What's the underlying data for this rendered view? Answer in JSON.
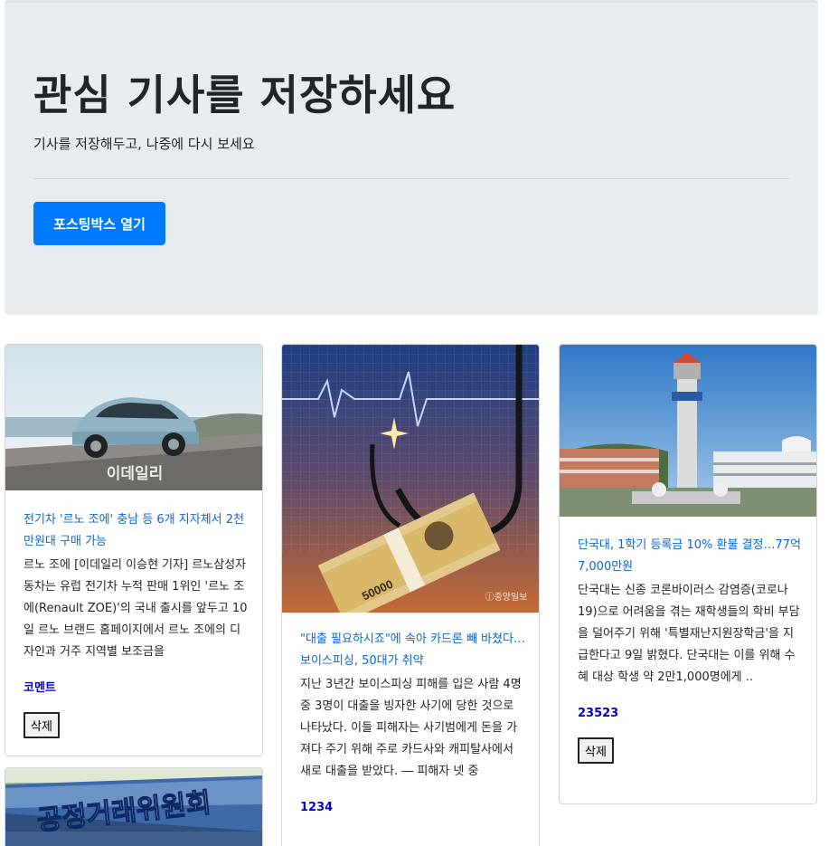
{
  "hero": {
    "title": "관심 기사를 저장하세요",
    "subtitle": "기사를 저장해두고, 나중에 다시 보세요",
    "button_label": "포스팅박스 열기",
    "button_color": "#007bff",
    "background": "#e9ecef"
  },
  "cards": [
    {
      "title": "전기차 '르노 조에' 충남 등 6개 지자체서 2천만원대 구매 가능",
      "description": "르노 조에 [이데일리 이승현 기자] 르노삼성자동차는 유럽 전기차 누적 판매 1위인 '르노 조에(Renault ZOE)'의 국내 출시를 앞두고 10일 르노 브랜드 홈페이지에서 르노 조에의 디자인과 거주 지역별 보조금을",
      "comment": "코멘트",
      "delete_label": "삭제",
      "image_watermark": "이데일리"
    },
    {
      "title": "\"대출 필요하시죠\"에 속아 카드론 빼 바쳤다…보이스피싱, 50대가 취약",
      "description": "지난 3년간 보이스피싱 피해를 입은 사람 4명 중 3명이 대출을 빙자한 사기에 당한 것으로 나타났다. 이들 피해자는 사기범에게 돈을 가져다 주기 위해 주로 카드사와 캐피탈사에서 새로 대출을 받았다. ― 피해자 넷 중",
      "comment": "1234",
      "image_watermark": "ⓙ중앙일보",
      "image_banknote": "50000"
    },
    {
      "title": "단국대, 1학기 등록금 10% 환불 결정…77억7,000만원",
      "description": "단국대는 신종 코론바이러스 감염증(코로나19)으로 어려움을 겪는 재학생들의 학비 부담을 덜어주기 위해 '특별재난지원장학금'을 지급한다고 9일 밝혔다. 단국대는 이를 위해 수혜 대상 학생 약 2만1,000명에게 ..",
      "comment": "23523",
      "delete_label": "삭제"
    },
    {
      "image_text": "공정거래위원회"
    }
  ]
}
